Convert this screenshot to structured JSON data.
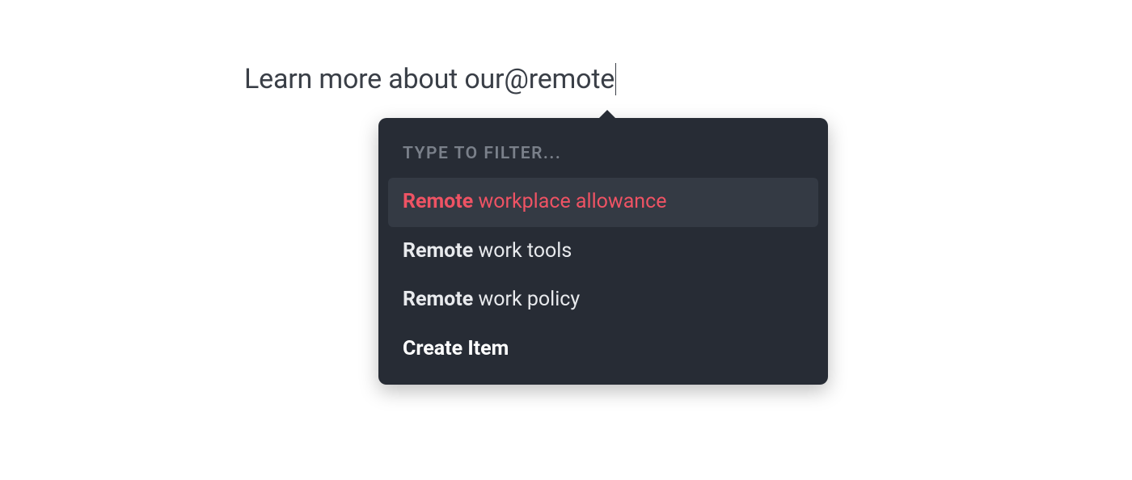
{
  "input": {
    "prefix_text": "Learn more about our ",
    "mention_text": "@remote"
  },
  "dropdown": {
    "filter_label": "TYPE TO FILTER...",
    "items": [
      {
        "match": "Remote",
        "rest": " workplace allowance",
        "selected": true
      },
      {
        "match": "Remote",
        "rest": " work tools",
        "selected": false
      },
      {
        "match": "Remote",
        "rest": " work policy",
        "selected": false
      }
    ],
    "create_item_label": "Create Item"
  }
}
